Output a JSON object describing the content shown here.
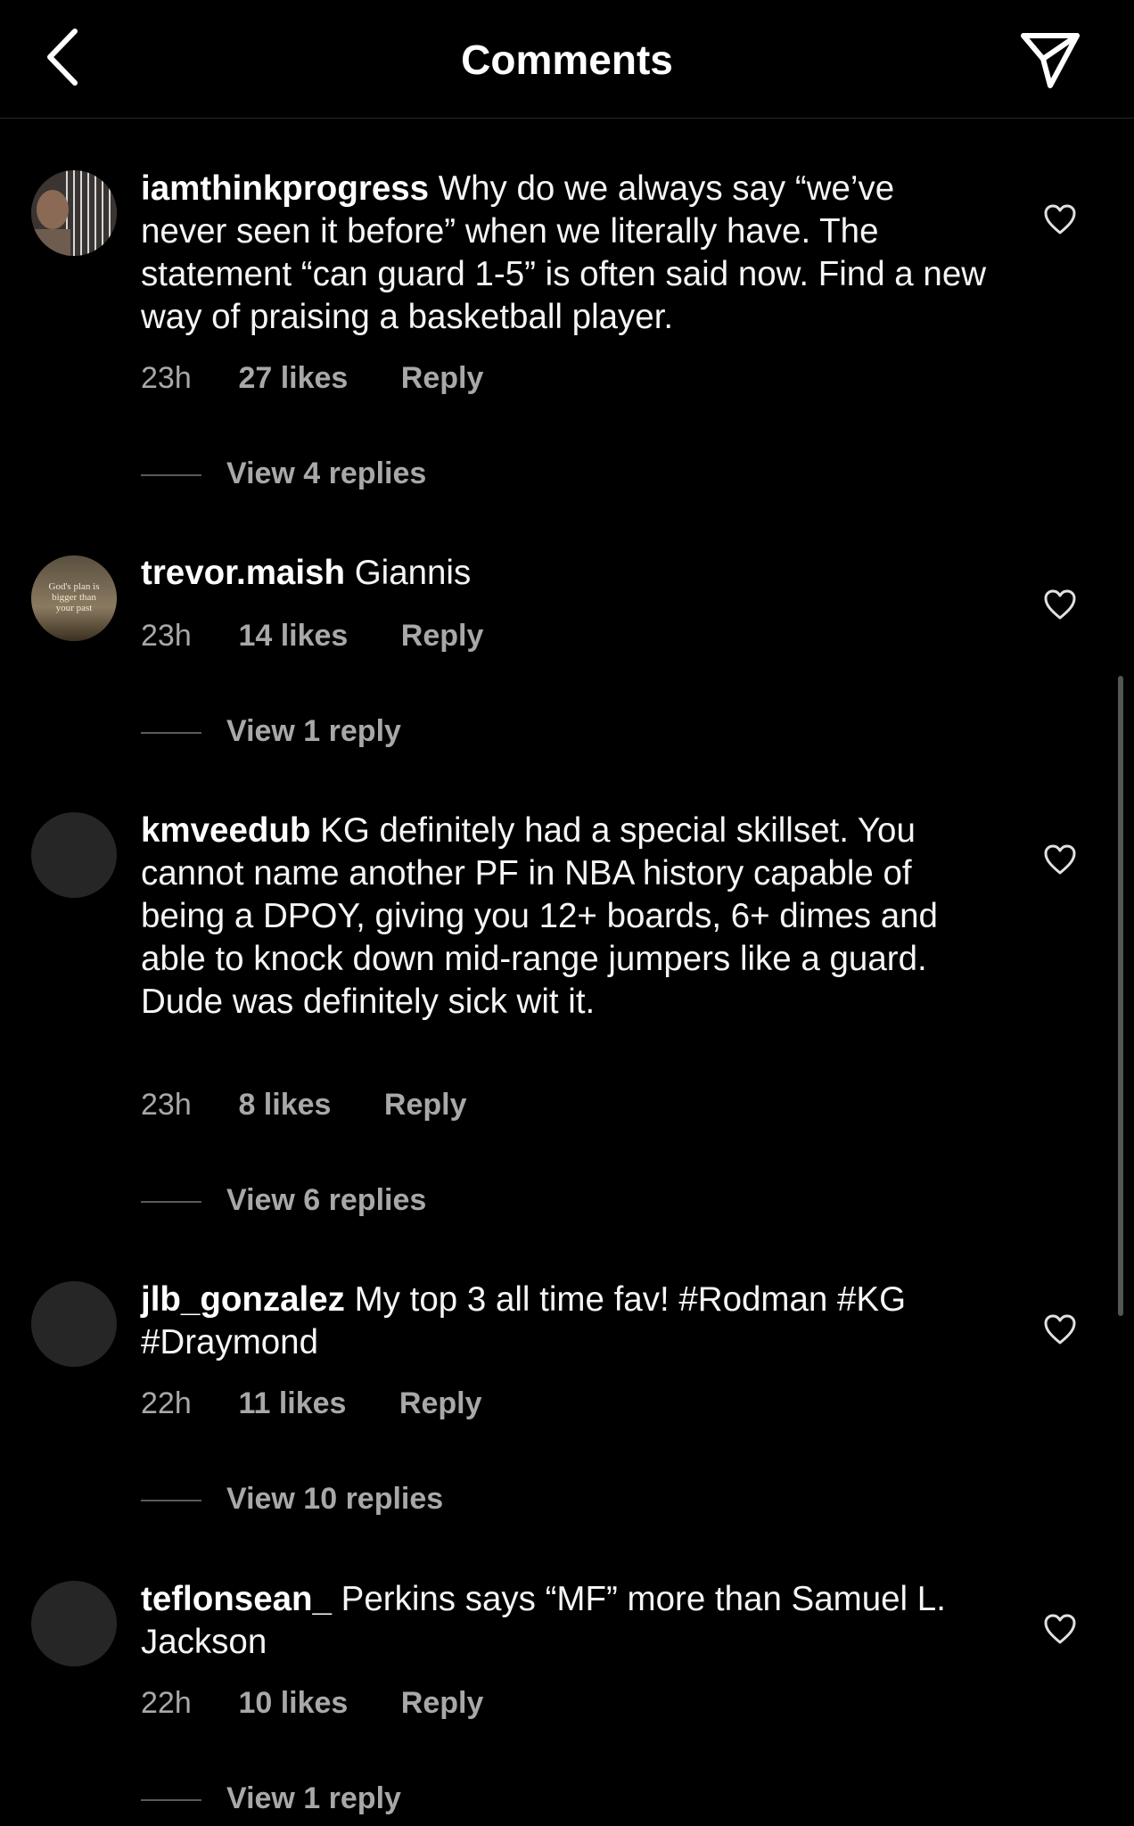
{
  "header": {
    "title": "Comments",
    "back_icon": "chevron-left-icon",
    "share_icon": "paper-plane-icon"
  },
  "comments": [
    {
      "username": "iamthinkprogress",
      "text": "Why do we always say “we’ve never seen it before” when we literally have. The statement “can guard 1-5” is often said now. Find a new way of praising a basketball player.",
      "time": "23h",
      "likes": "27 likes",
      "reply": "Reply",
      "view_replies": "View 4 replies"
    },
    {
      "username": "trevor.maish",
      "text": "Giannis",
      "time": "23h",
      "likes": "14 likes",
      "reply": "Reply",
      "view_replies": "View 1 reply",
      "avatar_text": [
        "God's plan is",
        "bigger than",
        "your past"
      ]
    },
    {
      "username": "kmveedub",
      "text": "KG definitely had a special skillset. You cannot name another PF in NBA history capable of being a DPOY, giving you 12+ boards, 6+ dimes and able to knock down mid-range jumpers like a guard. Dude was definitely sick wit it.",
      "time": "23h",
      "likes": "8 likes",
      "reply": "Reply",
      "view_replies": "View 6 replies"
    },
    {
      "username": "jlb_gonzalez",
      "text": "My top 3 all time fav! #Rodman #KG #Draymond",
      "time": "22h",
      "likes": "11 likes",
      "reply": "Reply",
      "view_replies": "View 10 replies"
    },
    {
      "username": "teflonsean_",
      "text": "Perkins says “MF” more than Samuel L. Jackson",
      "time": "22h",
      "likes": "10 likes",
      "reply": "Reply",
      "view_replies": "View 1 reply"
    }
  ],
  "colors": {
    "background": "#000000",
    "text": "#f5f5f5",
    "secondary_text": "#a8a8a8",
    "avatar_placeholder": "#262626"
  }
}
